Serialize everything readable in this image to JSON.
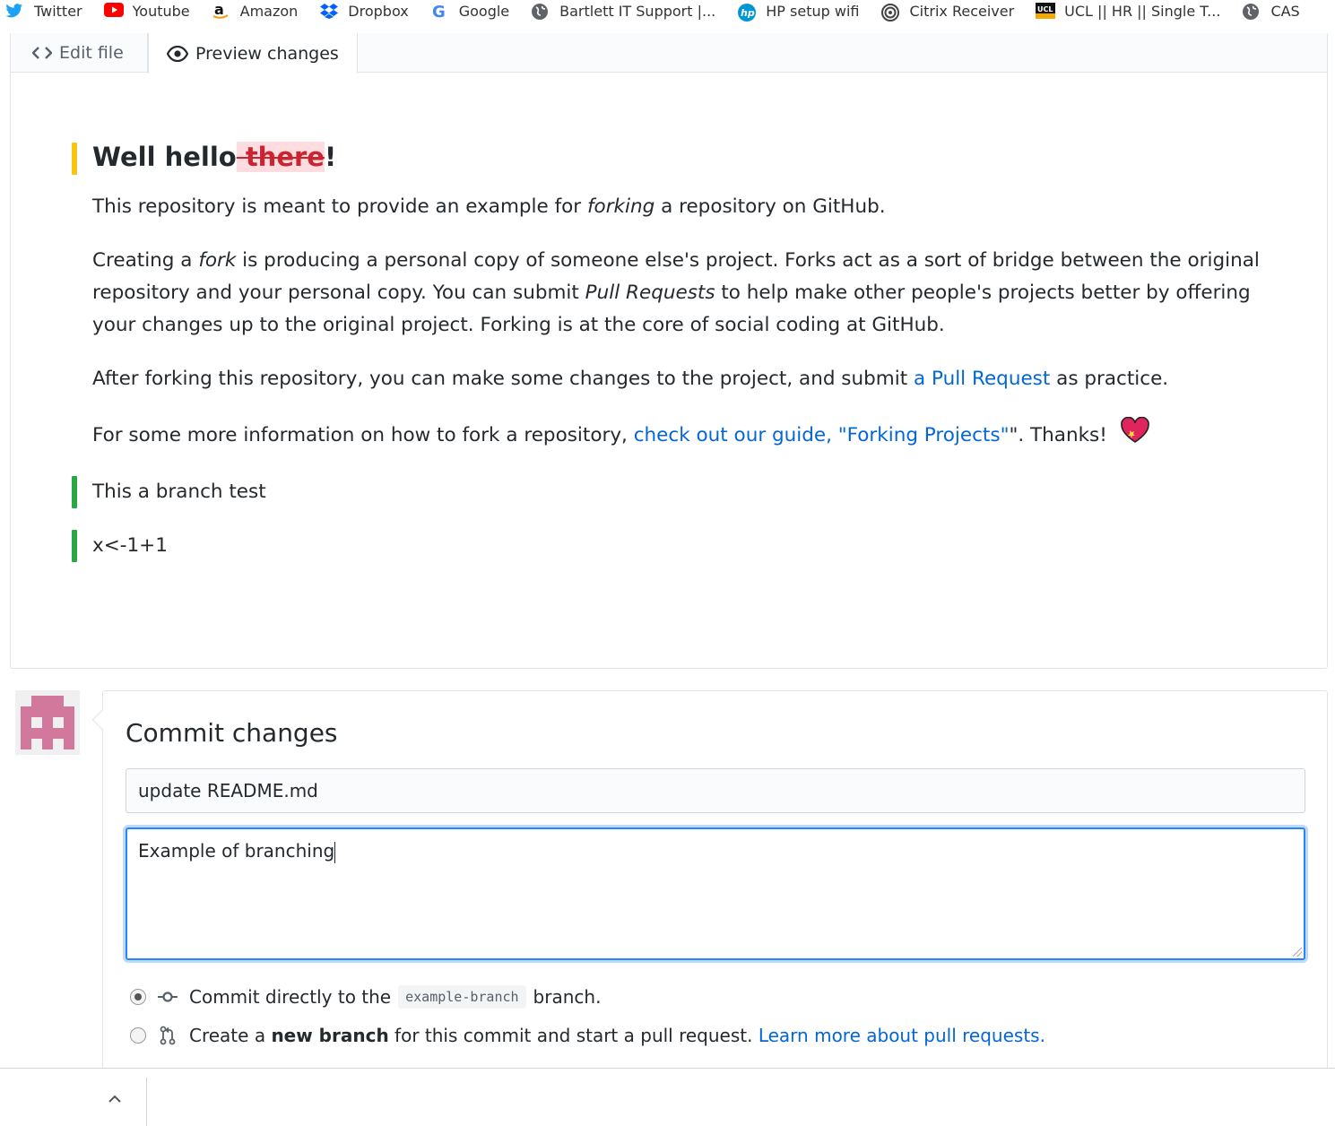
{
  "bookmarks": [
    {
      "label": "Twitter",
      "icon": "twitter-icon",
      "color": "#1da1f2"
    },
    {
      "label": "Youtube",
      "icon": "youtube-icon",
      "color": "#ff0000"
    },
    {
      "label": "Amazon",
      "icon": "amazon-icon",
      "color": "#ff9900"
    },
    {
      "label": "Dropbox",
      "icon": "dropbox-icon",
      "color": "#0061ff"
    },
    {
      "label": "Google",
      "icon": "google-icon",
      "color": "#4285f4"
    },
    {
      "label": "Bartlett IT Support |...",
      "icon": "globe-icon",
      "color": "#555555"
    },
    {
      "label": "HP setup wifi",
      "icon": "hp-icon",
      "color": "#0096d6"
    },
    {
      "label": "Citrix Receiver",
      "icon": "citrix-icon",
      "color": "#555555"
    },
    {
      "label": "UCL || HR || Single T...",
      "icon": "ucl-icon",
      "color": "#000000"
    },
    {
      "label": "CAS",
      "icon": "globe-icon",
      "color": "#555555"
    }
  ],
  "editor": {
    "tab_edit": "Edit file",
    "tab_preview": "Preview changes"
  },
  "preview": {
    "heading_prefix": "Well hello",
    "heading_deleted": " there",
    "heading_suffix": "!",
    "p1_a": "This repository is meant to provide an example for ",
    "p1_em": "forking",
    "p1_b": " a repository on GitHub.",
    "p2_a": "Creating a ",
    "p2_em1": "fork",
    "p2_b": " is producing a personal copy of someone else's project. Forks act as a sort of bridge between the original repository and your personal copy. You can submit ",
    "p2_em2": "Pull Requests",
    "p2_c": " to help make other people's projects better by offering your changes up to the original project. Forking is at the core of social coding at GitHub.",
    "p3_a": "After forking this repository, you can make some changes to the project, and submit ",
    "p3_link": "a Pull Request",
    "p3_b": " as practice.",
    "p4_a": "For some more information on how to fork a repository, ",
    "p4_link": "check out our guide, \"Forking Projects\"",
    "p4_b": "\". Thanks! ",
    "added1": "This a branch test",
    "added2": "x<-1+1"
  },
  "commit": {
    "title": "Commit changes",
    "summary_value": "update README.md",
    "description_value": "Example of branching",
    "option1_a": "Commit directly to the",
    "option1_branch": "example-branch",
    "option1_b": "branch.",
    "option2_a": "Create a ",
    "option2_bold": "new branch",
    "option2_b": " for this commit and start a pull request. ",
    "option2_link": "Learn more about pull requests."
  },
  "colors": {
    "link": "#0366d6",
    "deleted_bg": "#ffdce0",
    "deleted_text": "#cb2431",
    "changed_bar": "#f9c513",
    "added_bar": "#28a745",
    "focus_border": "#2188ff"
  }
}
